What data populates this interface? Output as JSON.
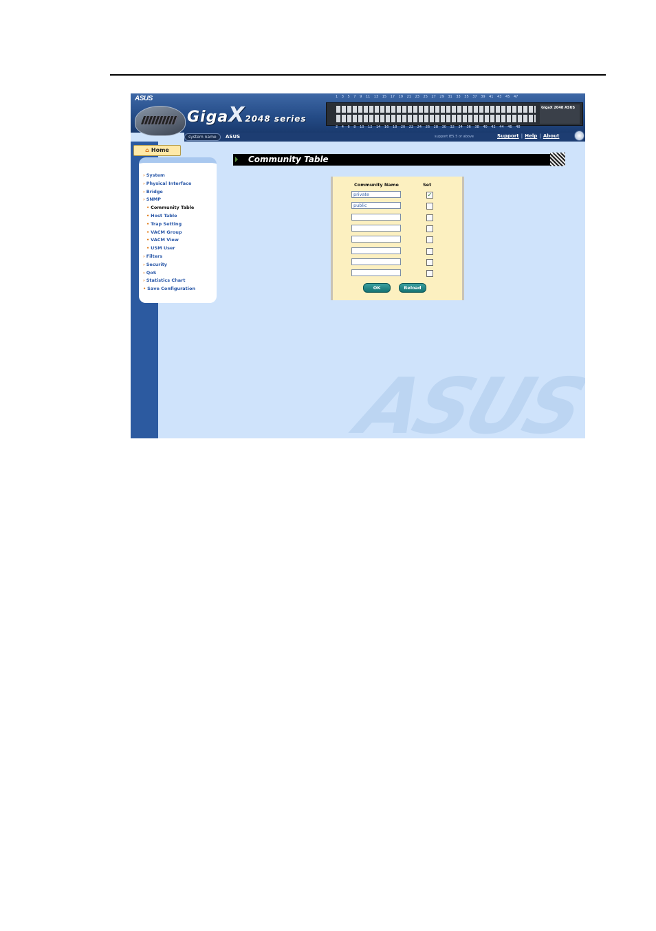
{
  "header": {
    "brand_logo": "ASUS",
    "product_name": "Giga",
    "product_x": "X",
    "product_series": "2048 series",
    "ports_top": "1 3 5 7 9 11 13 15 17 19 21 23 25 27 29 31 33 35 37 39 41 43 45 47",
    "ports_bottom": "2 4 6 8 10 12 14 16 18 20 22 24 26 28 30 32 34 36 38 40 42 44 46 48",
    "switch_badge": "GigaX 2048 ASUS",
    "system_name_label": "system name",
    "system_name_value": "ASUS",
    "support_note": "support IE5.5 or above",
    "links": [
      "Support",
      "Help",
      "About"
    ]
  },
  "sidebar": {
    "home_label": "Home",
    "items": [
      {
        "label": "System",
        "sub": false
      },
      {
        "label": "Physical Interface",
        "sub": false
      },
      {
        "label": "Bridge",
        "sub": false
      },
      {
        "label": "SNMP",
        "sub": false
      },
      {
        "label": "Community Table",
        "sub": true,
        "active": true
      },
      {
        "label": "Host Table",
        "sub": true
      },
      {
        "label": "Trap Setting",
        "sub": true
      },
      {
        "label": "VACM Group",
        "sub": true
      },
      {
        "label": "VACM View",
        "sub": true
      },
      {
        "label": "USM User",
        "sub": true
      },
      {
        "label": "Filters",
        "sub": false
      },
      {
        "label": "Security",
        "sub": false
      },
      {
        "label": "QoS",
        "sub": false
      },
      {
        "label": "Statistics Chart",
        "sub": false
      },
      {
        "label": "Save Configuration",
        "sub": false
      }
    ]
  },
  "main": {
    "page_title": "Community Table",
    "table": {
      "col_name": "Community Name",
      "col_set": "Set",
      "rows": [
        {
          "name": "private",
          "set": true
        },
        {
          "name": "public",
          "set": false
        },
        {
          "name": "",
          "set": false
        },
        {
          "name": "",
          "set": false
        },
        {
          "name": "",
          "set": false
        },
        {
          "name": "",
          "set": false
        },
        {
          "name": "",
          "set": false
        },
        {
          "name": "",
          "set": false
        }
      ]
    },
    "ok_label": "OK",
    "reload_label": "Reload"
  },
  "watermark": "ASUS",
  "colors": {
    "background": "#cfe3fb",
    "sidebar": "#2c5aa0",
    "table_bg": "#fcf0c0",
    "button": "#147272"
  }
}
